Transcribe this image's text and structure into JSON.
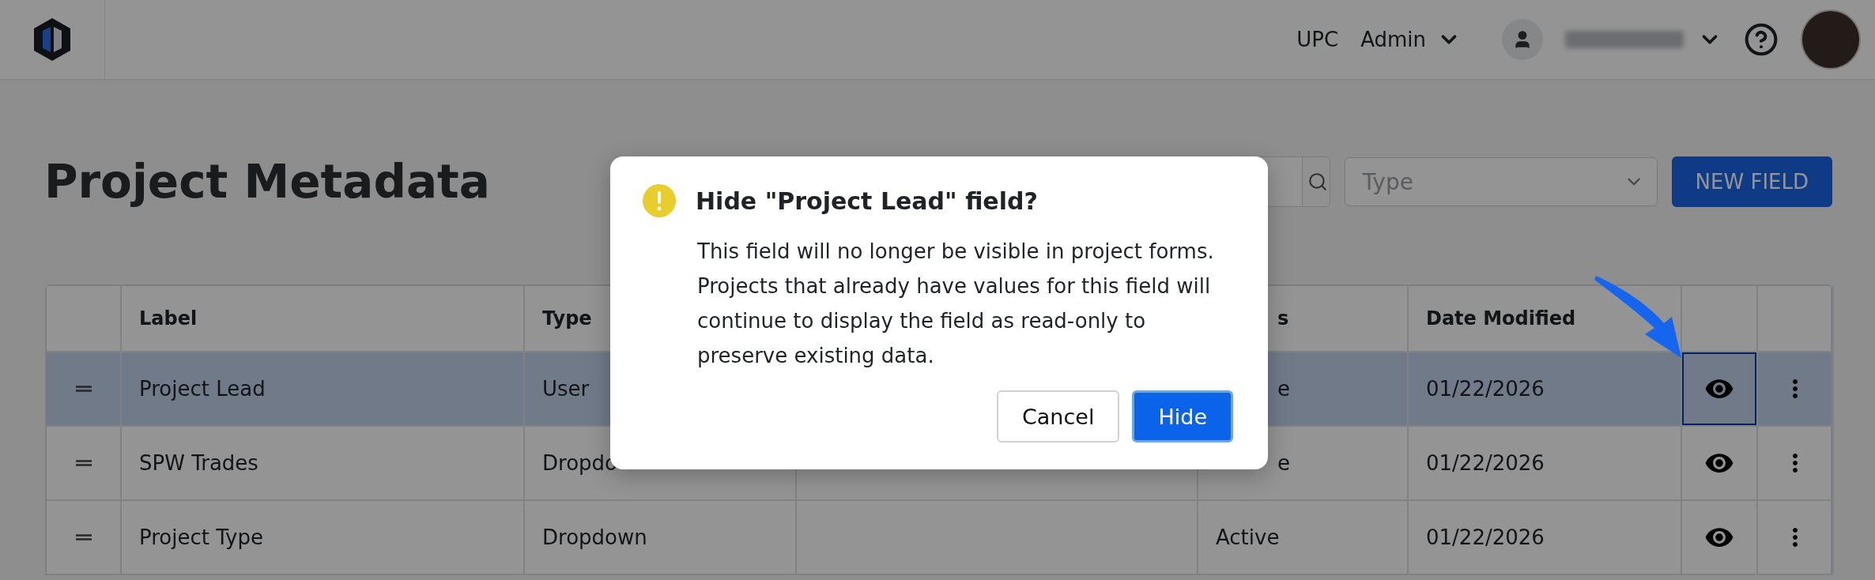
{
  "header": {
    "org": "UPC",
    "role_menu": "Admin"
  },
  "page": {
    "title": "Project Metadata",
    "type_filter": {
      "placeholder": "Type"
    },
    "new_button": "NEW FIELD"
  },
  "table": {
    "columns": [
      null,
      "Label",
      "Type",
      null,
      "s",
      "Date Modified",
      null,
      null
    ],
    "rows": [
      {
        "label": "Project Lead",
        "type": "User",
        "status": "e",
        "date_modified": "01/22/2026",
        "selected": true,
        "visibility_focused": true
      },
      {
        "label": "SPW Trades",
        "type": "Dropdo",
        "status": "e",
        "date_modified": "01/22/2026",
        "selected": false,
        "visibility_focused": false
      },
      {
        "label": "Project Type",
        "type": "Dropdown",
        "status": "Active",
        "date_modified": "01/22/2026",
        "selected": false,
        "visibility_focused": false
      }
    ]
  },
  "dialog": {
    "title": "Hide \"Project Lead\" field?",
    "body": "This field will no longer be visible in project forms. Projects that already have values for this field will continue to display the field as read-only to preserve existing data.",
    "buttons": [
      {
        "label": "Cancel",
        "kind": "secondary"
      },
      {
        "label": "Hide",
        "kind": "primary"
      }
    ]
  }
}
